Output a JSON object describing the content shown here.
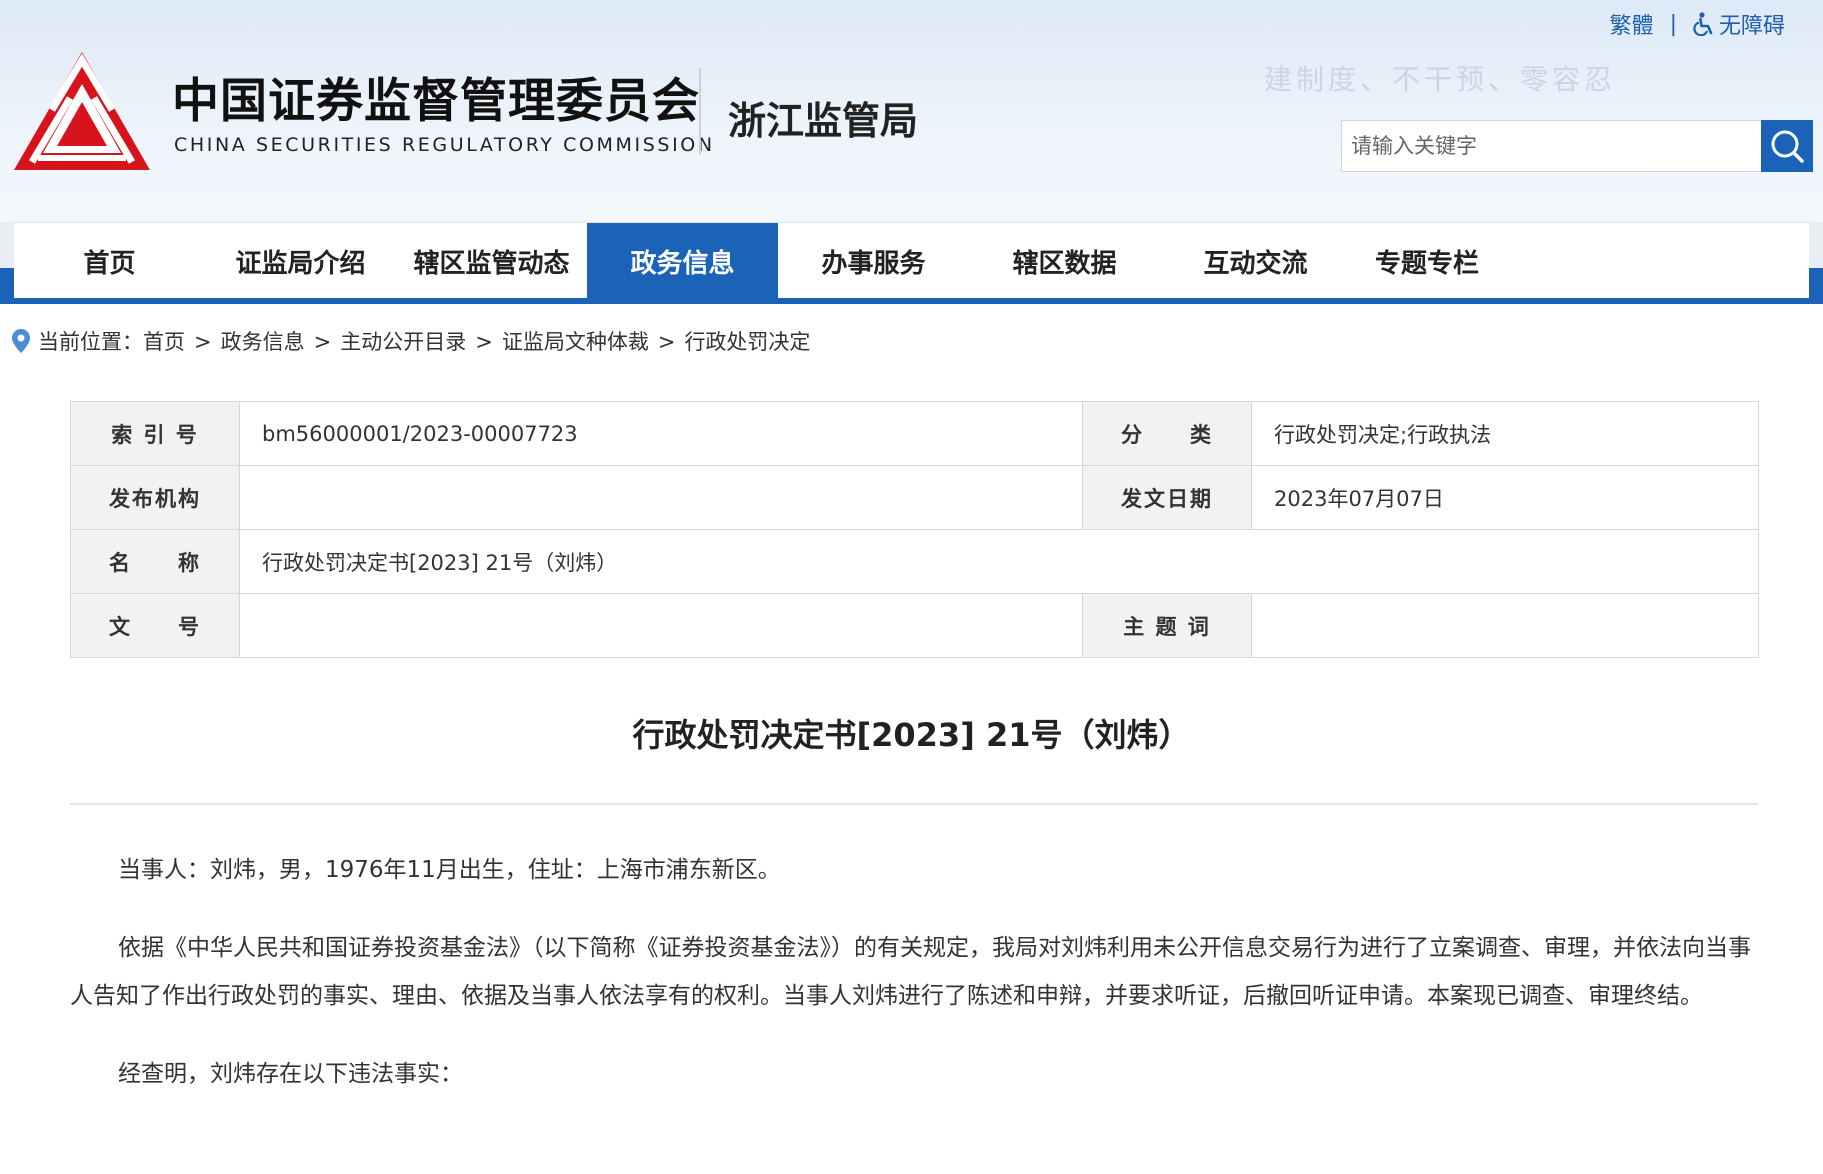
{
  "header": {
    "traditional_label": "繁體",
    "divider": "|",
    "accessibility_label": "无障碍",
    "org_name_cn": "中国证券监督管理委员会",
    "org_name_en": "CHINA SECURITIES REGULATORY COMMISSION",
    "bureau": "浙江监管局",
    "slogan": "建制度、不干预、零容忍",
    "search_placeholder": "请输入关键字",
    "brand_red": "#d7141d",
    "brand_blue": "#1a63b8"
  },
  "nav": {
    "items": [
      {
        "label": "首页",
        "active": false
      },
      {
        "label": "证监局介绍",
        "active": false
      },
      {
        "label": "辖区监管动态",
        "active": false
      },
      {
        "label": "政务信息",
        "active": true
      },
      {
        "label": "办事服务",
        "active": false
      },
      {
        "label": "辖区数据",
        "active": false
      },
      {
        "label": "互动交流",
        "active": false
      },
      {
        "label": "专题专栏",
        "active": false
      }
    ]
  },
  "breadcrumb": {
    "prefix": "当前位置：",
    "items": [
      "首页",
      "政务信息",
      "主动公开目录",
      "证监局文种体裁",
      "行政处罚决定"
    ],
    "sep": ">"
  },
  "meta": {
    "index_label": "索 引 号",
    "index_value": "bm56000001/2023-00007723",
    "category_label": "分　　类",
    "category_value": "行政处罚决定;行政执法",
    "publisher_label": "发布机构",
    "publisher_value": "",
    "date_label": "发文日期",
    "date_value": "2023年07月07日",
    "name_label": "名　　称",
    "name_value": "行政处罚决定书[2023] 21号（刘炜）",
    "docno_label": "文　　号",
    "docno_value": "",
    "keywords_label": "主 题 词",
    "keywords_value": ""
  },
  "article": {
    "title": "行政处罚决定书[2023] 21号（刘炜）",
    "paragraphs": [
      "当事人：刘炜，男，1976年11月出生，住址：上海市浦东新区。",
      "依据《中华人民共和国证券投资基金法》（以下简称《证券投资基金法》）的有关规定，我局对刘炜利用未公开信息交易行为进行了立案调查、审理，并依法向当事人告知了作出行政处罚的事实、理由、依据及当事人依法享有的权利。当事人刘炜进行了陈述和申辩，并要求听证，后撤回听证申请。本案现已调查、审理终结。",
      "经查明，刘炜存在以下违法事实："
    ]
  }
}
